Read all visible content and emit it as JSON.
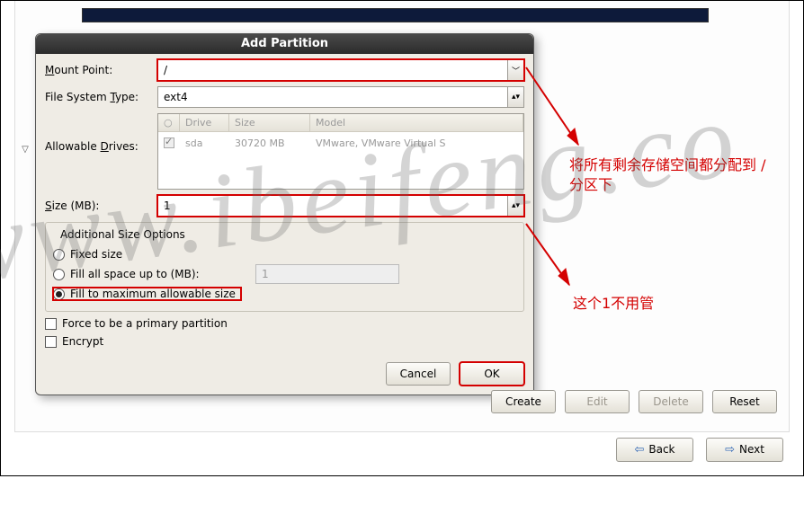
{
  "dialog": {
    "title": "Add Partition",
    "mount_label_pre": "M",
    "mount_label_post": "ount Point:",
    "mount_value": "/",
    "fstype_label_pre": "File System ",
    "fstype_label_u": "T",
    "fstype_label_post": "ype:",
    "fstype_value": "ext4",
    "drives_label": "Allowable ",
    "drives_label_u": "D",
    "drives_label_post": "rives:",
    "drives_head_drive": "Drive",
    "drives_head_size": "Size",
    "drives_head_model": "Model",
    "drive_row": {
      "name": "sda",
      "size": "30720 MB",
      "model": "VMware, VMware Virtual S"
    },
    "size_label_pre": "S",
    "size_label_post": "ize (MB):",
    "size_value": "1",
    "group_title": "Additional Size Options",
    "opt_fixed_pre": "F",
    "opt_fixed_post": "ixed size",
    "opt_fill_upto": "Fill all space ",
    "opt_fill_upto_u": "u",
    "opt_fill_upto_post": "p to (MB):",
    "opt_fill_upto_val": "1",
    "opt_fill_max": "Fill to maximum ",
    "opt_fill_max_u": "a",
    "opt_fill_max_post": "llowable size",
    "force_primary": "Force to be a ",
    "force_primary_u": "p",
    "force_primary_post": "rimary partition",
    "encrypt_pre": "E",
    "encrypt_u": "n",
    "encrypt_post": "crypt",
    "cancel": "Cancel",
    "cancel_u": "C",
    "cancel_post": "ancel",
    "ok": "OK",
    "ok_u": "O",
    "ok_post": "K"
  },
  "bottom": {
    "create_u": "C",
    "create": "reate",
    "edit_u": "E",
    "edit": "dit",
    "delete_u": "D",
    "delete": "elete",
    "reset_u": "s",
    "reset_pre": "Re",
    "reset_post": "et"
  },
  "nav": {
    "back_u": "B",
    "back": "ack",
    "next_u": "N",
    "next": "ext"
  },
  "annotations": {
    "top": "将所有剩余存储空间都分配到 /分区下",
    "bottom": "这个1不用管"
  },
  "watermark": "www.ibeifeng.co"
}
